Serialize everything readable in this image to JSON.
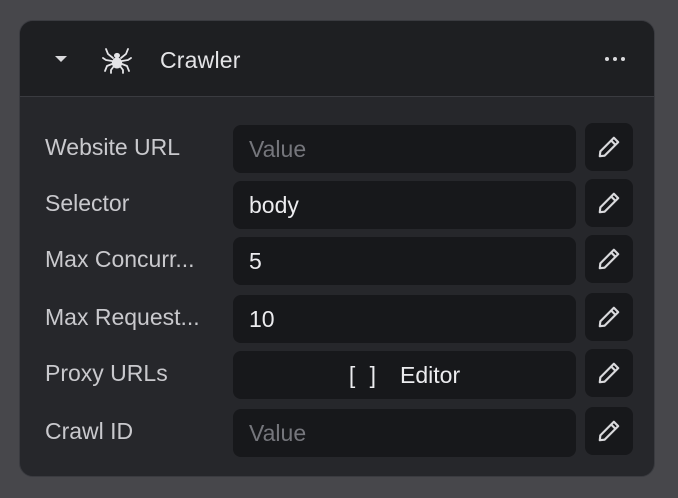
{
  "node": {
    "title": "Crawler",
    "icon": "spider-icon"
  },
  "fields": [
    {
      "label": "Website URL",
      "value": "",
      "placeholder": "Value"
    },
    {
      "label": "Selector",
      "value": "body",
      "placeholder": ""
    },
    {
      "label": "Max Concurr...",
      "value": "5",
      "placeholder": ""
    },
    {
      "label": "Max Request...",
      "value": "10",
      "placeholder": ""
    },
    {
      "label": "Proxy URLs",
      "value": "Editor",
      "brackets": "[ ]"
    },
    {
      "label": "Crawl ID",
      "value": "",
      "placeholder": "Value"
    }
  ],
  "colors": {
    "background": "#47474b",
    "panel": "#26272b",
    "header": "#1e1f22",
    "field": "#17181b",
    "text": "#ececef",
    "placeholder": "#75767c"
  }
}
